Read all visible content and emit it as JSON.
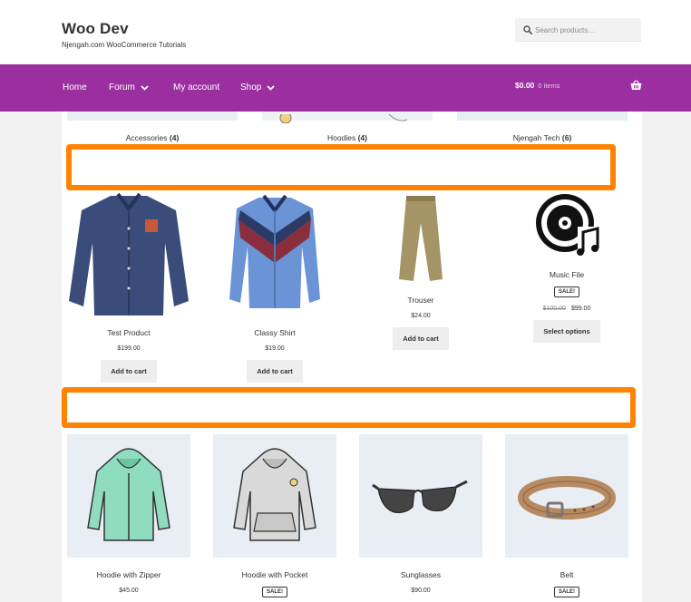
{
  "site": {
    "title": "Woo Dev",
    "tagline": "Njengah.com WooCommerce Tutorials"
  },
  "search": {
    "placeholder": "Search products…"
  },
  "nav": {
    "items": [
      {
        "label": "Home",
        "has_dropdown": false
      },
      {
        "label": "Forum",
        "has_dropdown": true
      },
      {
        "label": "My account",
        "has_dropdown": false
      },
      {
        "label": "Shop",
        "has_dropdown": true
      }
    ],
    "cart_total": "$0.00",
    "cart_count": "0 items",
    "color": "#9b2fa0"
  },
  "categories": [
    {
      "name": "Accessories",
      "count": "(4)"
    },
    {
      "name": "Hoodies",
      "count": "(4)"
    },
    {
      "name": "Njengah Tech",
      "count": "(6)"
    }
  ],
  "highlight_color": "#ff8200",
  "products_row1": [
    {
      "name": "Test Product",
      "price": "$199.00",
      "button": "Add to cart",
      "icon": "dark-shirt-image"
    },
    {
      "name": "Classy Shirt",
      "price": "$19.00",
      "button": "Add to cart",
      "icon": "blue-shirt-image"
    },
    {
      "name": "Trouser",
      "price": "$24.00",
      "button": "Add to cart",
      "icon": "trouser-image"
    },
    {
      "name": "Music File",
      "sale": "SALE!",
      "old_price": "$100.00",
      "price": "$99.00",
      "button": "Select options",
      "icon": "music-disc-icon"
    }
  ],
  "products_row2": [
    {
      "name": "Hoodie with Zipper",
      "price": "$45.00",
      "icon": "hoodie-zipper-image"
    },
    {
      "name": "Hoodie with Pocket",
      "sale": "SALE!",
      "icon": "hoodie-pocket-image"
    },
    {
      "name": "Sunglasses",
      "price": "$90.00",
      "icon": "sunglasses-image"
    },
    {
      "name": "Belt",
      "sale": "SALE!",
      "icon": "belt-image"
    }
  ]
}
